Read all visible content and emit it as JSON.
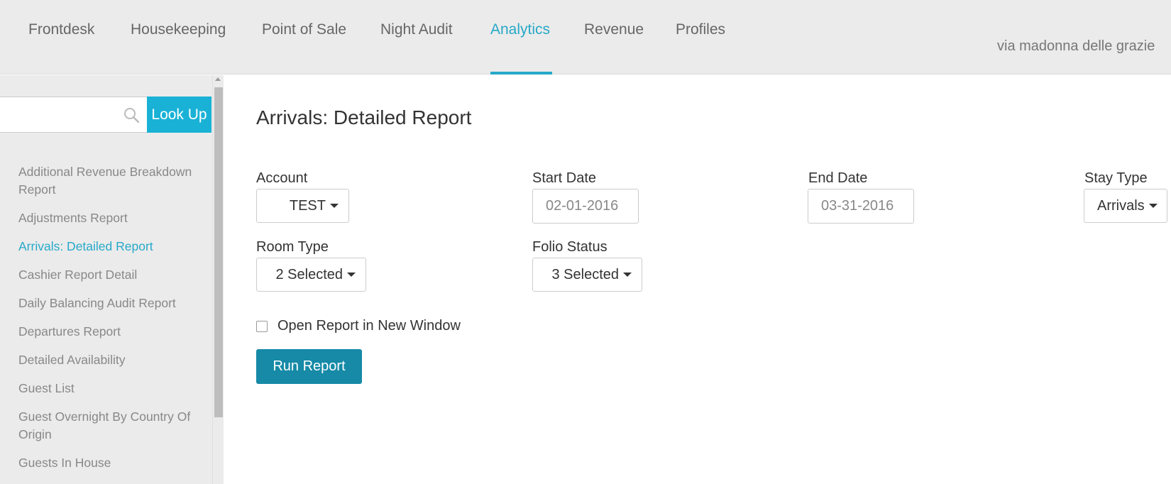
{
  "nav": {
    "tabs": [
      {
        "label": "Frontdesk"
      },
      {
        "label": "Housekeeping"
      },
      {
        "label": "Point of Sale"
      },
      {
        "label": "Night Audit"
      },
      {
        "label": "Analytics",
        "active": true
      },
      {
        "label": "Revenue"
      },
      {
        "label": "Profiles"
      }
    ],
    "property_name": "via madonna delle grazie"
  },
  "sidebar": {
    "search": {
      "value": "",
      "placeholder": ""
    },
    "lookup_label": "Look Up",
    "reports": [
      {
        "label": "Additional Revenue Breakdown Report"
      },
      {
        "label": "Adjustments Report"
      },
      {
        "label": "Arrivals: Detailed Report",
        "active": true
      },
      {
        "label": "Cashier Report Detail"
      },
      {
        "label": "Daily Balancing Audit Report"
      },
      {
        "label": "Departures Report"
      },
      {
        "label": "Detailed Availability"
      },
      {
        "label": "Guest List"
      },
      {
        "label": "Guest Overnight By Country Of Origin"
      },
      {
        "label": "Guests In House"
      }
    ]
  },
  "main": {
    "title": "Arrivals: Detailed Report",
    "account": {
      "label": "Account",
      "value": "TEST"
    },
    "start_date": {
      "label": "Start Date",
      "value": "02-01-2016"
    },
    "end_date": {
      "label": "End Date",
      "value": "03-31-2016"
    },
    "stay_type": {
      "label": "Stay Type",
      "value": "Arrivals"
    },
    "room_type": {
      "label": "Room Type",
      "value": "2 Selected"
    },
    "folio_status": {
      "label": "Folio Status",
      "value": "3 Selected"
    },
    "open_new_window": {
      "label": "Open Report in New Window",
      "checked": false
    },
    "run_label": "Run Report"
  },
  "colors": {
    "accent": "#27a9c9",
    "lookup_button": "#19b2d6",
    "run_button": "#168aa7",
    "topbar_bg": "#ebebeb"
  },
  "icons": {
    "search": "search-icon",
    "caret": "caret-down-icon"
  }
}
